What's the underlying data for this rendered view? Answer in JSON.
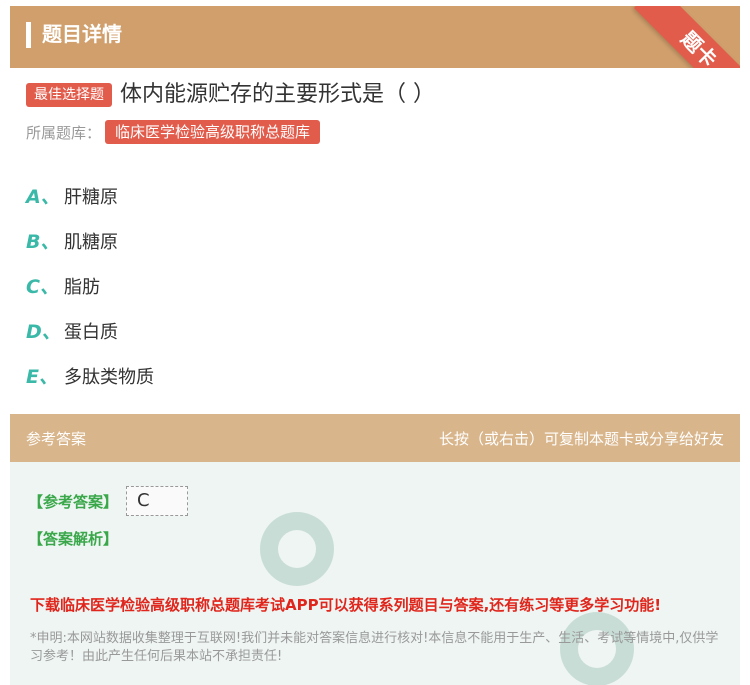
{
  "header": {
    "title": "题目详情",
    "ribbon": "题卡"
  },
  "question": {
    "type_tag": "最佳选择题",
    "text": "体内能源贮存的主要形式是（ ）",
    "bank_label": "所属题库：",
    "bank_name": "临床医学检验高级职称总题库"
  },
  "options": [
    {
      "letter": "A、",
      "text": "肝糖原"
    },
    {
      "letter": "B、",
      "text": "肌糖原"
    },
    {
      "letter": "C、",
      "text": "脂肪"
    },
    {
      "letter": "D、",
      "text": "蛋白质"
    },
    {
      "letter": "E、",
      "text": "多肽类物质"
    }
  ],
  "answer_section": {
    "header_left": "参考答案",
    "header_right": "长按（或右击）可复制本题卡或分享给好友",
    "answer_label": "【参考答案】",
    "answer_value": "C",
    "explanation_label": "【答案解析】",
    "promo": "下载临床医学检验高级职称总题库考试APP可以获得系列题目与答案,还有练习等更多学习功能!",
    "disclaimer": "*申明:本网站数据收集整理于互联网!我们并未能对答案信息进行核对!本信息不能用于生产、生活、考试等情境中,仅供学习参考！由此产生任何后果本站不承担责任!"
  },
  "colors": {
    "header_bg": "#d09f6c",
    "tag_red": "#e25c4c",
    "option_letter": "#3ab8a8",
    "answer_label_green": "#3aa84a",
    "promo_red": "#e0261c"
  }
}
